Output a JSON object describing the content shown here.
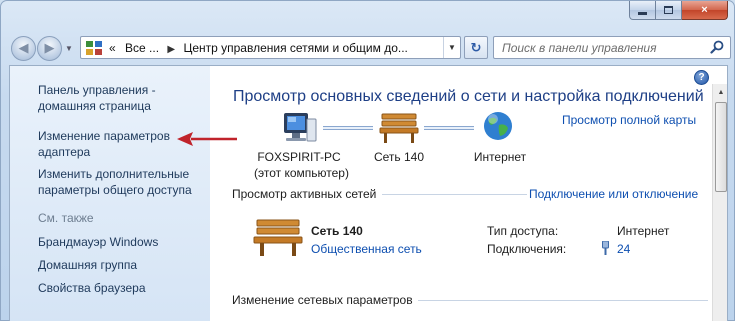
{
  "window": {
    "caption": {
      "minimize": "minimize",
      "maximize": "maximize",
      "close": "×"
    }
  },
  "nav": {
    "breadcrumb": [
      "«",
      "Все ...",
      "Центр управления сетями и общим до..."
    ],
    "search_placeholder": "Поиск в панели управления"
  },
  "sidebar": {
    "items": [
      "Панель управления - домашняя страница",
      "Изменение параметров адаптера",
      "Изменить дополнительные параметры общего доступа"
    ],
    "see_also_label": "См. также",
    "see_also": [
      "Брандмауэр Windows",
      "Домашняя группа",
      "Свойства браузера"
    ]
  },
  "main": {
    "help": "?",
    "title": "Просмотр основных сведений о сети и настройка подключений",
    "full_map_link": "Просмотр полной карты",
    "map": {
      "computer_name": "FOXSPIRIT-PC",
      "computer_sub": "(этот компьютер)",
      "network": "Сеть 140",
      "internet": "Интернет"
    },
    "active_networks": {
      "title": "Просмотр активных сетей",
      "connect_link": "Подключение или отключение",
      "network_name": "Сеть  140",
      "network_type": "Общественная сеть",
      "access_type_label": "Тип доступа:",
      "access_type_value": "Интернет",
      "connections_label": "Подключения:",
      "connections_value": "24"
    },
    "change_settings_title": "Изменение сетевых параметров"
  },
  "colors": {
    "link": "#0e4fb0",
    "title": "#1e3f86",
    "arrow": "#c0232b"
  }
}
